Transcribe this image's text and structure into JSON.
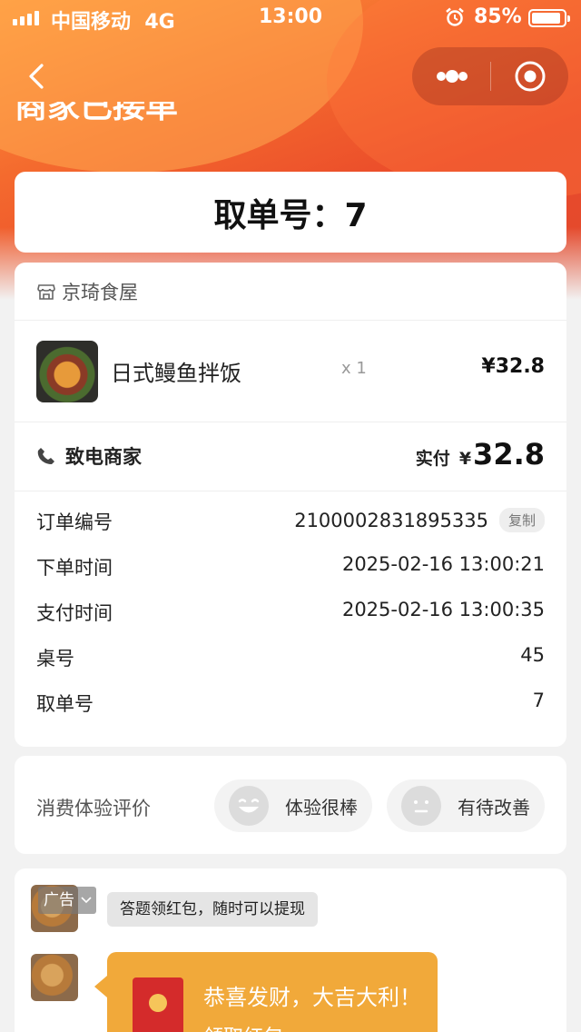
{
  "status_bar": {
    "carrier": "中国移动",
    "network": "4G",
    "time": "13:00",
    "battery": "85%",
    "battery_level": 0.85
  },
  "header": {
    "order_status": "商家已接单"
  },
  "pickup": {
    "label": "取单号：",
    "number": "7"
  },
  "shop": {
    "name": "京琦食屋",
    "icon": "store-icon"
  },
  "item": {
    "name": "日式鳗鱼拌饭",
    "quantity": "x 1",
    "price": "¥32.8"
  },
  "payment": {
    "call_label": "致电商家",
    "paid_label": "实付",
    "currency": "¥",
    "amount": "32.8"
  },
  "details": [
    {
      "label": "订单编号",
      "value": "2100002831895335",
      "action": "复制"
    },
    {
      "label": "下单时间",
      "value": "2025-02-16 13:00:21"
    },
    {
      "label": "支付时间",
      "value": "2025-02-16 13:00:35"
    },
    {
      "label": "桌号",
      "value": "45"
    },
    {
      "label": "取单号",
      "value": "7"
    }
  ],
  "rating": {
    "title": "消费体验评价",
    "good": "体验很棒",
    "improve": "有待改善"
  },
  "ad": {
    "tag": "广告",
    "bubble": "答题领红包，随时可以提现",
    "redpack_title": "恭喜发财，大吉大利！",
    "redpack_sub": "领取红包"
  },
  "colors": {
    "header_gradient_start": "#ff9a3c",
    "header_gradient_end": "#e14a2e",
    "redpack_bg": "#f1a93a",
    "envelope": "#d42b2b"
  }
}
